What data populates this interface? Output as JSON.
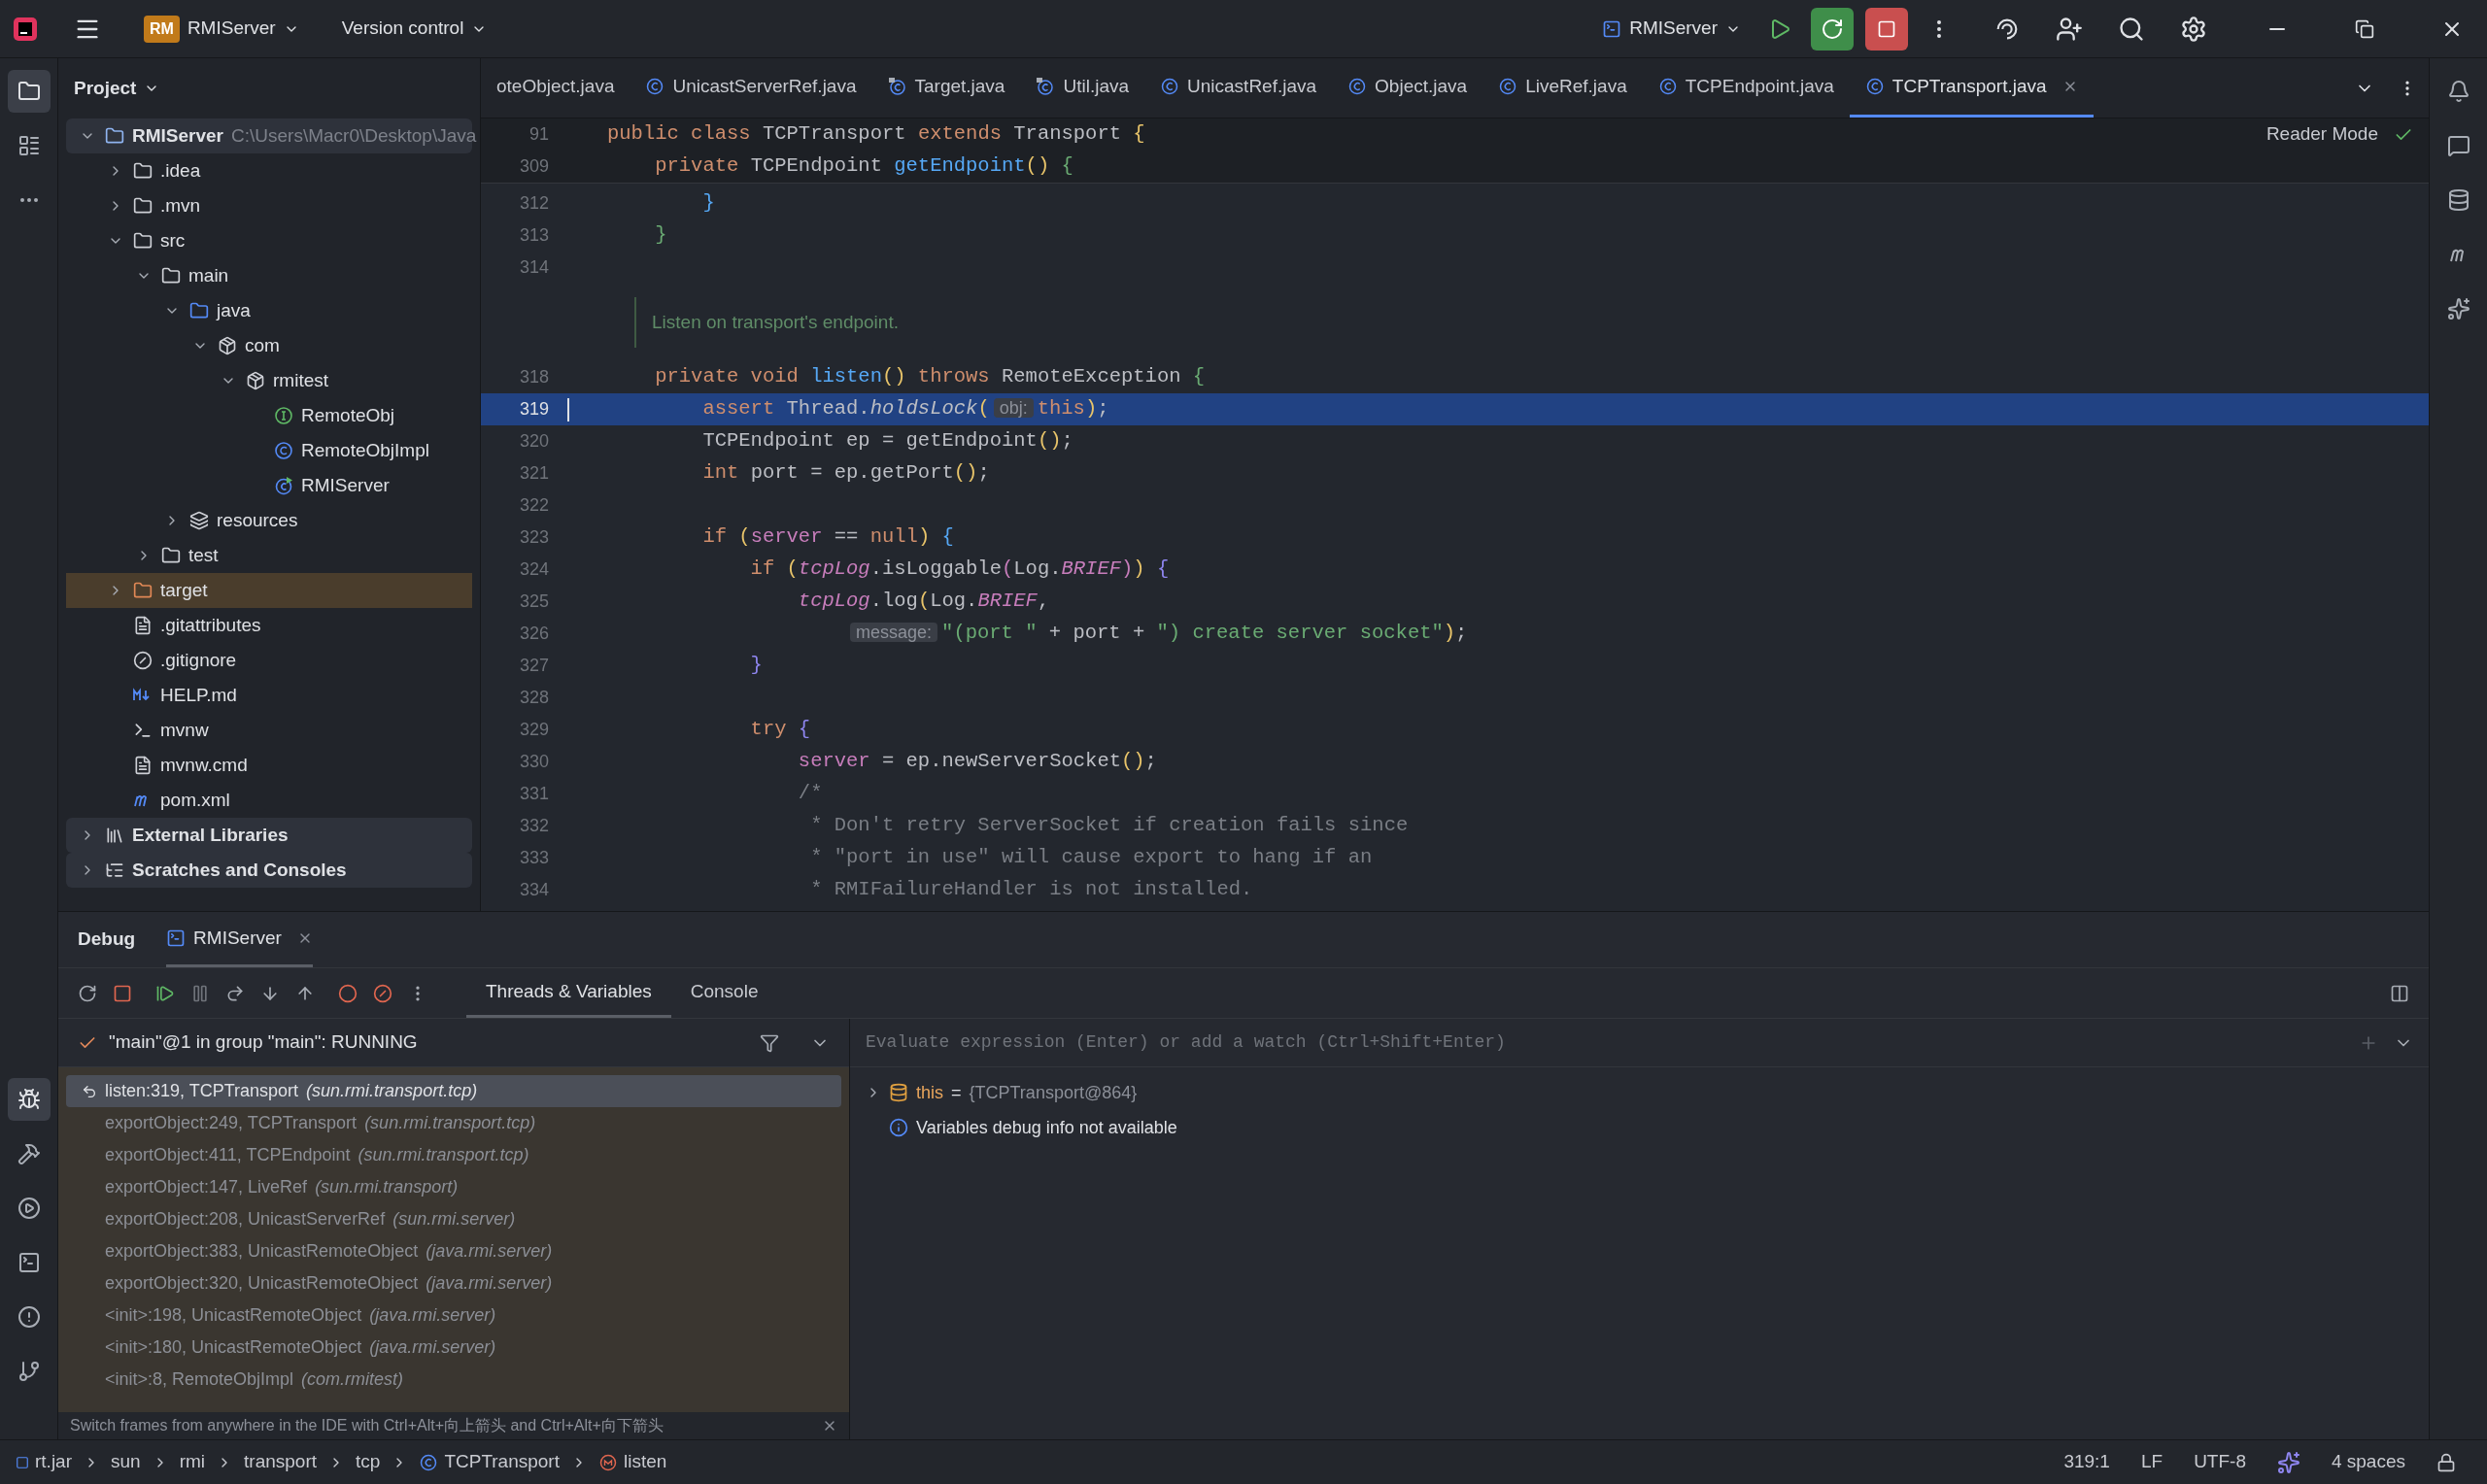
{
  "title_bar": {
    "project_badge": "RM",
    "project": "RMIServer",
    "vcs": "Version control",
    "run_config": "RMIServer"
  },
  "tool_windows": {
    "left_top": [
      {
        "kind": "project",
        "selected": true
      },
      {
        "kind": "structure",
        "selected": false
      },
      {
        "kind": "more",
        "selected": false
      }
    ],
    "left_bottom": [
      {
        "kind": "debug",
        "selected": true
      },
      {
        "kind": "build",
        "selected": false
      },
      {
        "kind": "run",
        "selected": false
      },
      {
        "kind": "terminal",
        "selected": false
      },
      {
        "kind": "problems",
        "selected": false
      },
      {
        "kind": "git",
        "selected": false
      }
    ],
    "right": [
      {
        "kind": "notifications",
        "selected": false
      },
      {
        "kind": "assistant",
        "selected": false
      },
      {
        "kind": "database",
        "selected": false
      },
      {
        "kind": "maven",
        "selected": false
      },
      {
        "kind": "ai",
        "selected": false
      }
    ]
  },
  "project_panel": {
    "title": "Project",
    "tree": [
      {
        "name": "RMIServer",
        "path": "C:\\Users\\Macr0\\Desktop\\Java",
        "kind": "module",
        "expanded": true,
        "selected": false,
        "children": [
          {
            "name": ".idea",
            "kind": "folder",
            "expanded": false,
            "selected": false
          },
          {
            "name": ".mvn",
            "kind": "folder",
            "expanded": false,
            "selected": false
          },
          {
            "name": "src",
            "kind": "folder",
            "expanded": true,
            "selected": false,
            "children": [
              {
                "name": "main",
                "kind": "folder",
                "expanded": true,
                "selected": false,
                "children": [
                  {
                    "name": "java",
                    "kind": "source",
                    "expanded": true,
                    "selected": false,
                    "children": [
                      {
                        "name": "com",
                        "kind": "package",
                        "expanded": true,
                        "selected": false,
                        "children": [
                          {
                            "name": "rmitest",
                            "kind": "package",
                            "expanded": true,
                            "selected": false,
                            "children": [
                              {
                                "name": "RemoteObj",
                                "kind": "interface",
                                "selected": false
                              },
                              {
                                "name": "RemoteObjImpl",
                                "kind": "class",
                                "selected": false
                              },
                              {
                                "name": "RMIServer",
                                "kind": "runclass",
                                "selected": false
                              }
                            ]
                          }
                        ]
                      }
                    ]
                  },
                  {
                    "name": "resources",
                    "kind": "resources",
                    "expanded": false,
                    "selected": false
                  }
                ]
              },
              {
                "name": "test",
                "kind": "folder",
                "expanded": false,
                "selected": false
              }
            ]
          },
          {
            "name": "target",
            "kind": "excluded",
            "expanded": false,
            "selected": true
          },
          {
            "name": ".gitattributes",
            "kind": "text",
            "selected": false
          },
          {
            "name": ".gitignore",
            "kind": "ignore",
            "selected": false
          },
          {
            "name": "HELP.md",
            "kind": "markdown",
            "selected": false
          },
          {
            "name": "mvnw",
            "kind": "script",
            "selected": false
          },
          {
            "name": "mvnw.cmd",
            "kind": "text",
            "selected": false
          },
          {
            "name": "pom.xml",
            "kind": "maven",
            "selected": false
          }
        ]
      },
      {
        "name": "External Libraries",
        "kind": "library",
        "expanded": false,
        "selected": false
      },
      {
        "name": "Scratches and Consoles",
        "kind": "scratches",
        "expanded": false,
        "selected": false
      }
    ]
  },
  "editor_tabs": [
    {
      "label": "oteObject.java",
      "kind": "none",
      "selected": false
    },
    {
      "label": "UnicastServerRef.java",
      "kind": "class",
      "selected": false
    },
    {
      "label": "Target.java",
      "kind": "final",
      "selected": false
    },
    {
      "label": "Util.java",
      "kind": "final",
      "selected": false
    },
    {
      "label": "UnicastRef.java",
      "kind": "class",
      "selected": false
    },
    {
      "label": "Object.java",
      "kind": "class",
      "selected": false
    },
    {
      "label": "LiveRef.java",
      "kind": "class",
      "selected": false
    },
    {
      "label": "TCPEndpoint.java",
      "kind": "class",
      "selected": false
    },
    {
      "label": "TCPTransport.java",
      "kind": "class",
      "selected": true
    }
  ],
  "reader_mode": "Reader Mode",
  "sticky_lines": [
    {
      "number": "91",
      "tokens": [
        {
          "kind": "keyword",
          "text": "public class "
        },
        {
          "kind": "text",
          "text": "TCPTransport "
        },
        {
          "kind": "keyword",
          "text": "extends "
        },
        {
          "kind": "text",
          "text": "Transport "
        },
        {
          "kind": "paren",
          "text": "{",
          "color": "#e8c46a"
        }
      ]
    },
    {
      "number": "309",
      "tokens": [
        {
          "kind": "keyword",
          "text": "    private "
        },
        {
          "kind": "text",
          "text": "TCPEndpoint "
        },
        {
          "kind": "declaration",
          "text": "getEndpoint"
        },
        {
          "kind": "paren",
          "text": "()",
          "color": "#e8c46a"
        },
        {
          "kind": "paren",
          "text": " {",
          "color": "#6aab73"
        }
      ]
    }
  ],
  "code_lines": [
    {
      "number": "312",
      "kind": "code",
      "current": false,
      "tokens": [
        {
          "kind": "paren",
          "text": "        }",
          "color": "#56a8f5"
        }
      ]
    },
    {
      "number": "313",
      "kind": "code",
      "current": false,
      "tokens": [
        {
          "kind": "paren",
          "text": "    }",
          "color": "#6aab73"
        }
      ]
    },
    {
      "number": "314",
      "kind": "code",
      "current": false
    },
    {
      "kind": "doc",
      "text": "Listen on transport's endpoint."
    },
    {
      "number": "318",
      "kind": "code",
      "current": false,
      "tokens": [
        {
          "kind": "keyword",
          "text": "    private void "
        },
        {
          "kind": "declaration",
          "text": "listen"
        },
        {
          "kind": "paren",
          "text": "()",
          "color": "#e8c46a"
        },
        {
          "kind": "keyword",
          "text": " throws "
        },
        {
          "kind": "text",
          "text": "RemoteException "
        },
        {
          "kind": "paren",
          "text": "{",
          "color": "#6aab73"
        }
      ]
    },
    {
      "number": "319",
      "kind": "code",
      "current": true,
      "tokens": [
        {
          "kind": "keyword",
          "text": "        assert "
        },
        {
          "kind": "text",
          "text": "Thread."
        },
        {
          "kind": "italic",
          "text": "holdsLock"
        },
        {
          "kind": "paren",
          "text": "(",
          "color": "#e8c46a"
        },
        {
          "kind": "hint",
          "text": "obj:"
        },
        {
          "kind": "keyword",
          "text": "this"
        },
        {
          "kind": "paren",
          "text": ")",
          "color": "#e8c46a"
        },
        {
          "kind": "text",
          "text": ";"
        }
      ]
    },
    {
      "number": "320",
      "kind": "code",
      "current": false,
      "tokens": [
        {
          "kind": "text",
          "text": "        TCPEndpoint ep = getEndpoint"
        },
        {
          "kind": "paren",
          "text": "()",
          "color": "#e8c46a"
        },
        {
          "kind": "text",
          "text": ";"
        }
      ]
    },
    {
      "number": "321",
      "kind": "code",
      "current": false,
      "tokens": [
        {
          "kind": "keyword",
          "text": "        int "
        },
        {
          "kind": "text",
          "text": "port = ep.getPort"
        },
        {
          "kind": "paren",
          "text": "()",
          "color": "#e8c46a"
        },
        {
          "kind": "text",
          "text": ";"
        }
      ]
    },
    {
      "number": "322",
      "kind": "code",
      "current": false
    },
    {
      "number": "323",
      "kind": "code",
      "current": false,
      "tokens": [
        {
          "kind": "keyword",
          "text": "        if "
        },
        {
          "kind": "paren",
          "text": "(",
          "color": "#e8c46a"
        },
        {
          "kind": "field",
          "text": "server"
        },
        {
          "kind": "text",
          "text": " == "
        },
        {
          "kind": "keyword",
          "text": "null"
        },
        {
          "kind": "paren",
          "text": ")",
          "color": "#e8c46a"
        },
        {
          "kind": "paren",
          "text": " {",
          "color": "#56a8f5"
        }
      ]
    },
    {
      "number": "324",
      "kind": "code",
      "current": false,
      "tokens": [
        {
          "kind": "keyword",
          "text": "            if "
        },
        {
          "kind": "paren",
          "text": "(",
          "color": "#e8c46a"
        },
        {
          "kind": "static",
          "text": "tcpLog"
        },
        {
          "kind": "text",
          "text": ".isLoggable"
        },
        {
          "kind": "paren",
          "text": "(",
          "color": "#c77dbb"
        },
        {
          "kind": "text",
          "text": "Log."
        },
        {
          "kind": "static",
          "text": "BRIEF"
        },
        {
          "kind": "paren",
          "text": ")",
          "color": "#c77dbb"
        },
        {
          "kind": "paren",
          "text": ")",
          "color": "#e8c46a"
        },
        {
          "kind": "paren",
          "text": " {",
          "color": "#8f86f0"
        }
      ]
    },
    {
      "number": "325",
      "kind": "code",
      "current": false,
      "tokens": [
        {
          "kind": "static",
          "text": "                tcpLog"
        },
        {
          "kind": "text",
          "text": ".log"
        },
        {
          "kind": "paren",
          "text": "(",
          "color": "#e8c46a"
        },
        {
          "kind": "text",
          "text": "Log."
        },
        {
          "kind": "static",
          "text": "BRIEF"
        },
        {
          "kind": "text",
          "text": ","
        }
      ]
    },
    {
      "number": "326",
      "kind": "code",
      "current": false,
      "tokens": [
        {
          "kind": "hint",
          "text": "                    message:"
        },
        {
          "kind": "string",
          "text": "\"(port \""
        },
        {
          "kind": "text",
          "text": " + port + "
        },
        {
          "kind": "string",
          "text": "\") create server socket\""
        },
        {
          "kind": "paren",
          "text": ")",
          "color": "#e8c46a"
        },
        {
          "kind": "text",
          "text": ";"
        }
      ]
    },
    {
      "number": "327",
      "kind": "code",
      "current": false,
      "tokens": [
        {
          "kind": "paren",
          "text": "            }",
          "color": "#8f86f0"
        }
      ]
    },
    {
      "number": "328",
      "kind": "code",
      "current": false
    },
    {
      "number": "329",
      "kind": "code",
      "current": false,
      "tokens": [
        {
          "kind": "keyword",
          "text": "            try "
        },
        {
          "kind": "paren",
          "text": "{",
          "color": "#8f86f0"
        }
      ]
    },
    {
      "number": "330",
      "kind": "code",
      "current": false,
      "tokens": [
        {
          "kind": "field",
          "text": "                server"
        },
        {
          "kind": "text",
          "text": " = ep.newServerSocket"
        },
        {
          "kind": "paren",
          "text": "()",
          "color": "#e8c46a"
        },
        {
          "kind": "text",
          "text": ";"
        }
      ]
    },
    {
      "number": "331",
      "kind": "code",
      "current": false,
      "tokens": [
        {
          "kind": "comment",
          "text": "                /*"
        }
      ]
    },
    {
      "number": "332",
      "kind": "code",
      "current": false,
      "tokens": [
        {
          "kind": "comment",
          "text": "                 * Don't retry ServerSocket if creation fails since"
        }
      ]
    },
    {
      "number": "333",
      "kind": "code",
      "current": false,
      "tokens": [
        {
          "kind": "comment",
          "text": "                 * \"port in use\" will cause export to hang if an"
        }
      ]
    },
    {
      "number": "334",
      "kind": "code",
      "current": false,
      "tokens": [
        {
          "kind": "comment",
          "text": "                 * RMIFailureHandler is not installed."
        }
      ]
    }
  ],
  "debug": {
    "title": "Debug",
    "session": "RMIServer",
    "tabs": [
      {
        "label": "Threads & Variables",
        "selected": true
      },
      {
        "label": "Console",
        "selected": false
      }
    ],
    "thread": "\"main\"@1 in group \"main\": RUNNING",
    "frames": [
      {
        "method": "listen:319, TCPTransport",
        "package": "(sun.rmi.transport.tcp)",
        "selected": true
      },
      {
        "method": "exportObject:249, TCPTransport",
        "package": "(sun.rmi.transport.tcp)",
        "selected": false
      },
      {
        "method": "exportObject:411, TCPEndpoint",
        "package": "(sun.rmi.transport.tcp)",
        "selected": false
      },
      {
        "method": "exportObject:147, LiveRef",
        "package": "(sun.rmi.transport)",
        "selected": false
      },
      {
        "method": "exportObject:208, UnicastServerRef",
        "package": "(sun.rmi.server)",
        "selected": false
      },
      {
        "method": "exportObject:383, UnicastRemoteObject",
        "package": "(java.rmi.server)",
        "selected": false
      },
      {
        "method": "exportObject:320, UnicastRemoteObject",
        "package": "(java.rmi.server)",
        "selected": false
      },
      {
        "method": "<init>:198, UnicastRemoteObject",
        "package": "(java.rmi.server)",
        "selected": false
      },
      {
        "method": "<init>:180, UnicastRemoteObject",
        "package": "(java.rmi.server)",
        "selected": false
      },
      {
        "method": "<init>:8, RemoteObjImpl",
        "package": "(com.rmitest)",
        "selected": false
      }
    ],
    "hint": "Switch frames from anywhere in the IDE with Ctrl+Alt+向上箭头 and Ctrl+Alt+向下箭头",
    "evaluate_placeholder": "Evaluate expression (Enter) or add a watch (Ctrl+Shift+Enter)",
    "variables": [
      {
        "name": "this",
        "equals": "=",
        "value": "{TCPTransport@864}"
      }
    ],
    "info": "Variables debug info not available"
  },
  "breadcrumbs": [
    {
      "label": "rt.jar",
      "kind": "jar"
    },
    {
      "label": "sun",
      "kind": "package"
    },
    {
      "label": "rmi",
      "kind": "package"
    },
    {
      "label": "transport",
      "kind": "package"
    },
    {
      "label": "tcp",
      "kind": "package"
    },
    {
      "label": "TCPTransport",
      "kind": "class"
    },
    {
      "label": "listen",
      "kind": "method"
    }
  ],
  "status": {
    "position": "319:1",
    "line_separator": "LF",
    "encoding": "UTF-8",
    "indent": "4 spaces"
  }
}
